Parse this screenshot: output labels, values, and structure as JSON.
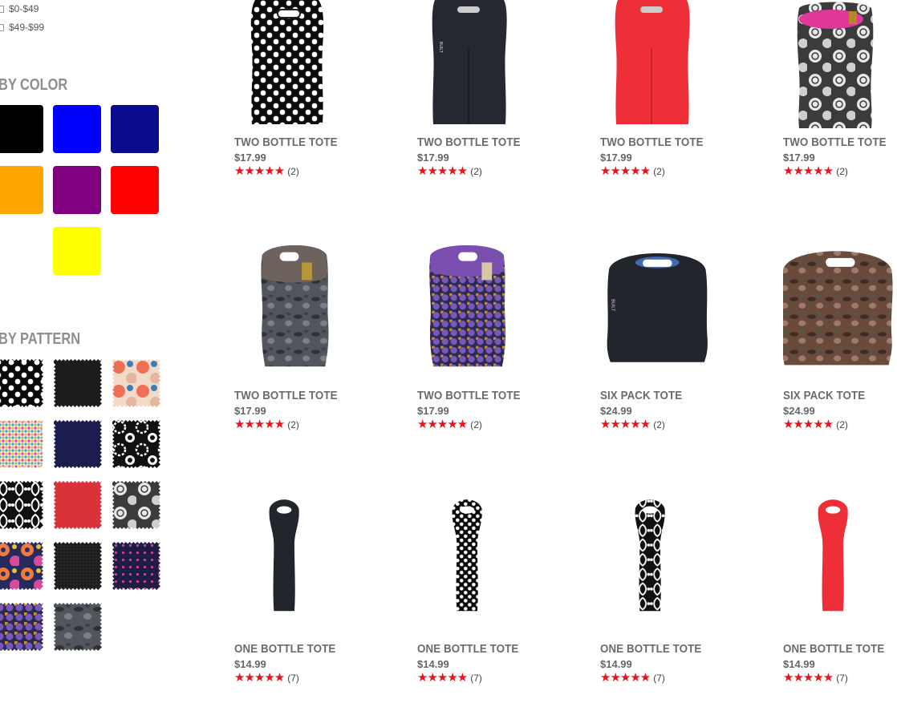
{
  "sidebar": {
    "price_filters": [
      {
        "label": "$0-$49",
        "checked": false
      },
      {
        "label": "$49-$99",
        "checked": false
      }
    ],
    "color_heading": "BY COLOR",
    "colors": [
      {
        "name": "black",
        "hex": "#000000"
      },
      {
        "name": "blue",
        "hex": "#0000ff"
      },
      {
        "name": "navy",
        "hex": "#0a0a8c"
      },
      {
        "name": "orange",
        "hex": "#ffa500"
      },
      {
        "name": "purple",
        "hex": "#800080"
      },
      {
        "name": "red",
        "hex": "#ff0000"
      },
      {
        "name": "yellow",
        "hex": "#ffff00"
      }
    ],
    "pattern_heading": "BY PATTERN",
    "patterns": [
      {
        "name": "white-dots-on-black"
      },
      {
        "name": "solid-black"
      },
      {
        "name": "pink-floral"
      },
      {
        "name": "multicolor-dots"
      },
      {
        "name": "solid-navy"
      },
      {
        "name": "black-white-floral"
      },
      {
        "name": "black-white-damask"
      },
      {
        "name": "solid-red"
      },
      {
        "name": "gray-rose"
      },
      {
        "name": "bright-floral"
      },
      {
        "name": "dark-texture"
      },
      {
        "name": "navy-pink-dots"
      },
      {
        "name": "purple-gold-dots"
      },
      {
        "name": "gray-camo"
      }
    ]
  },
  "products": [
    {
      "name": "TWO BOTTLE TOTE",
      "price": "$17.99",
      "stars": "★★★★★",
      "reviews": "(2)",
      "image": "two-bottle-polka-dot"
    },
    {
      "name": "TWO BOTTLE TOTE",
      "price": "$17.99",
      "stars": "★★★★★",
      "reviews": "(2)",
      "image": "two-bottle-black"
    },
    {
      "name": "TWO BOTTLE TOTE",
      "price": "$17.99",
      "stars": "★★★★★",
      "reviews": "(2)",
      "image": "two-bottle-red"
    },
    {
      "name": "TWO BOTTLE TOTE",
      "price": "$17.99",
      "stars": "★★★★★",
      "reviews": "(2)",
      "image": "two-bottle-floral"
    },
    {
      "name": "TWO BOTTLE TOTE",
      "price": "$17.99",
      "stars": "★★★★★",
      "reviews": "(2)",
      "image": "two-bottle-camo"
    },
    {
      "name": "TWO BOTTLE TOTE",
      "price": "$17.99",
      "stars": "★★★★★",
      "reviews": "(2)",
      "image": "two-bottle-purple-dots"
    },
    {
      "name": "SIX PACK TOTE",
      "price": "$24.99",
      "stars": "★★★★★",
      "reviews": "(2)",
      "image": "six-pack-black"
    },
    {
      "name": "SIX PACK TOTE",
      "price": "$24.99",
      "stars": "★★★★★",
      "reviews": "(2)",
      "image": "six-pack-camo"
    },
    {
      "name": "ONE BOTTLE TOTE",
      "price": "$14.99",
      "stars": "★★★★★",
      "reviews": "(7)",
      "image": "one-bottle-black"
    },
    {
      "name": "ONE BOTTLE TOTE",
      "price": "$14.99",
      "stars": "★★★★★",
      "reviews": "(7)",
      "image": "one-bottle-polka-dot"
    },
    {
      "name": "ONE BOTTLE TOTE",
      "price": "$14.99",
      "stars": "★★★★★",
      "reviews": "(7)",
      "image": "one-bottle-damask"
    },
    {
      "name": "ONE BOTTLE TOTE",
      "price": "$14.99",
      "stars": "★★★★★",
      "reviews": "(7)",
      "image": "one-bottle-red"
    }
  ],
  "colors": {
    "star": "#e8141b",
    "heading": "#8e8e8e",
    "product_name": "#6b6b6b"
  }
}
